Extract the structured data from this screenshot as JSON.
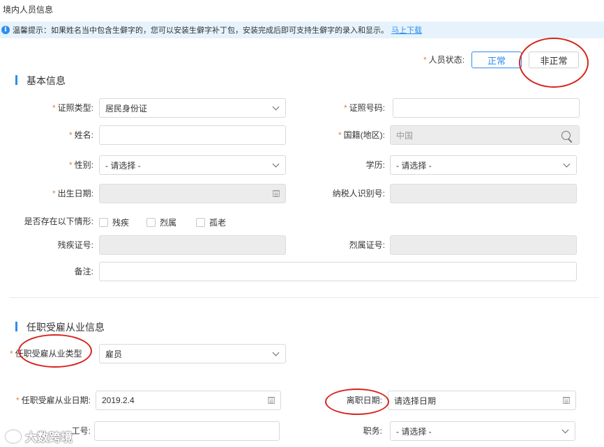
{
  "page": {
    "title": "境内人员信息"
  },
  "notice": {
    "text": "温馨提示：如果姓名当中包含生僻字的，您可以安装生僻字补丁包，安装完成后即可支持生僻字的录入和显示。",
    "link": "马上下载"
  },
  "status": {
    "label": "人员状态:",
    "normal": "正常",
    "abnormal": "非正常"
  },
  "basic": {
    "title": "基本信息",
    "id_type": {
      "label": "证照类型:",
      "value": "居民身份证"
    },
    "id_no": {
      "label": "证照号码:",
      "value": ""
    },
    "name": {
      "label": "姓名:",
      "value": ""
    },
    "nationality": {
      "label": "国籍(地区):",
      "value": "中国"
    },
    "gender": {
      "label": "性别:",
      "value": "- 请选择 -"
    },
    "education": {
      "label": "学历:",
      "value": "- 请选择 -"
    },
    "birth": {
      "label": "出生日期:",
      "value": ""
    },
    "tax_id": {
      "label": "纳税人识别号:",
      "value": ""
    },
    "situation": {
      "label": "是否存在以下情形:",
      "options": [
        "残疾",
        "烈属",
        "孤老"
      ]
    },
    "disability_no": {
      "label": "残疾证号:",
      "value": ""
    },
    "martyr_no": {
      "label": "烈属证号:",
      "value": ""
    },
    "remark": {
      "label": "备注:",
      "value": ""
    }
  },
  "employment": {
    "title": "任职受雇从业信息",
    "type": {
      "label": "任职受雇从业类型",
      "value": "雇员"
    },
    "start_date": {
      "label": "任职受雇从业日期:",
      "value": "2019.2.4"
    },
    "leave_date": {
      "label": "离职日期:",
      "placeholder": "请选择日期"
    },
    "job_no": {
      "label": "工号:",
      "value": ""
    },
    "position": {
      "label": "职务:",
      "value": "- 请选择 -"
    }
  },
  "watermark": "大数跨境",
  "colors": {
    "accent": "#2d8cf0",
    "required": "#e6803c",
    "annotation": "#d8231c",
    "notice_bg": "#e6f3fc"
  }
}
